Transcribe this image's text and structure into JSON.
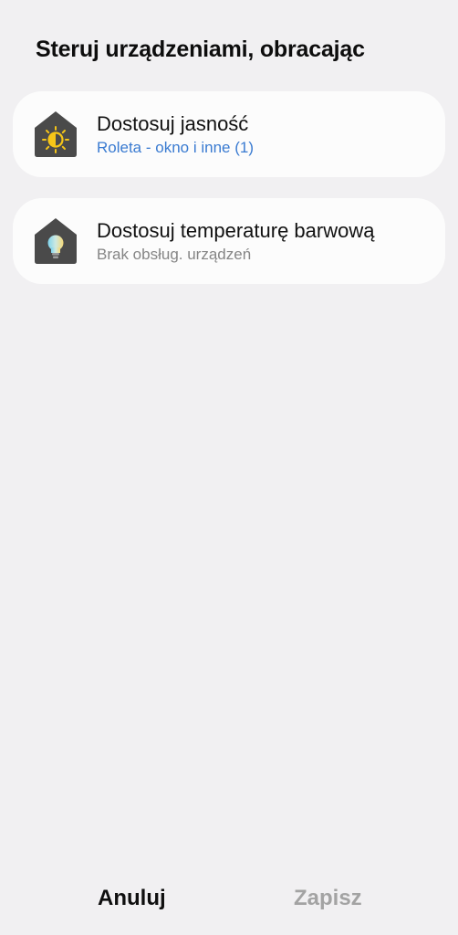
{
  "header": {
    "title": "Steruj urządzeniami, obracając"
  },
  "options": [
    {
      "title": "Dostosuj jasność",
      "subtitle": "Roleta - okno i inne (1)",
      "icon": "brightness-home-icon",
      "subtitle_color": "#3a7bd1"
    },
    {
      "title": "Dostosuj temperaturę barwową",
      "subtitle": "Brak obsług. urządzeń",
      "icon": "color-temperature-bulb-icon",
      "subtitle_color": "#858585"
    }
  ],
  "footer": {
    "cancel_label": "Anuluj",
    "save_label": "Zapisz"
  },
  "colors": {
    "background": "#f1f0f2",
    "card": "#fcfcfc",
    "icon_house": "#4a4a4a",
    "sun": "#f5c518",
    "save_disabled": "#a3a3a3"
  }
}
